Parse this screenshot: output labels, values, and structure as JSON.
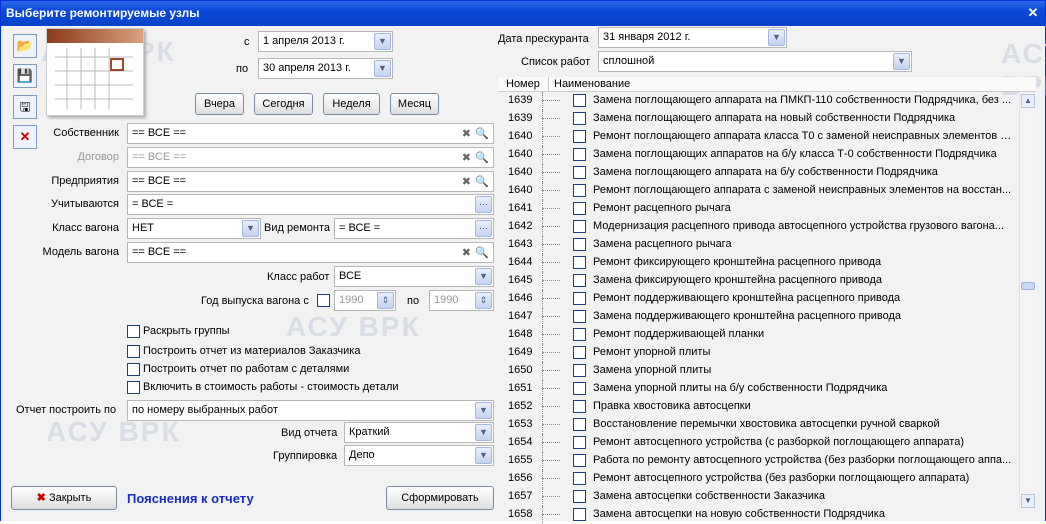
{
  "window": {
    "title": "Выберите ремонтируемые узлы",
    "close": "✕"
  },
  "dates": {
    "from_label": "с",
    "from": "1  апреля  2013 г.",
    "to_label": "по",
    "to": "30  апреля  2013 г."
  },
  "periods": [
    "Вчера",
    "Сегодня",
    "Неделя",
    "Месяц"
  ],
  "filters": {
    "owner": {
      "label": "Собственник",
      "value": "== ВСЕ =="
    },
    "contract": {
      "label": "Договор",
      "value": "== ВСЕ =="
    },
    "enterprise": {
      "label": "Предприятия",
      "value": "== ВСЕ =="
    },
    "counted": {
      "label": "Учитываются",
      "value": "= ВСЕ ="
    },
    "wagon_class": {
      "label": "Класс вагона",
      "value": "НЕТ"
    },
    "repair_type": {
      "label": "Вид ремонта",
      "value": "= ВСЕ ="
    },
    "wagon_model": {
      "label": "Модель вагона",
      "value": "== ВСЕ =="
    },
    "work_class": {
      "label": "Класс работ",
      "value": "ВСЕ"
    },
    "year": {
      "label": "Год выпуска вагона с",
      "from": "1990",
      "to_label": "по",
      "to": "1990"
    }
  },
  "options": [
    "Раскрыть группы",
    "Построить отчет из материалов Заказчика",
    "Построить отчет по работам с деталями",
    "Включить в стоимость работы - стоимость детали"
  ],
  "report": {
    "build_by_label": "Отчет построить по",
    "build_by": "по номеру выбранных работ",
    "kind_label": "Вид отчета",
    "kind": "Краткий",
    "group_label": "Группировка",
    "group": "Депо"
  },
  "buttons": {
    "close": "Закрыть",
    "explain": "Пояснения к отчету",
    "build": "Сформировать"
  },
  "pricelist": {
    "date_label": "Дата прескуранта",
    "date": "31  января   2012 г.",
    "worklist_label": "Список работ",
    "worklist": "сплошной"
  },
  "watermark": "АСУ ВРК",
  "list": {
    "headers": [
      "Номер",
      "Наименование"
    ],
    "rows": [
      {
        "n": "1639",
        "t": "Замена поглощающего аппарата на ПМКП-110 собственности Подрядчика, без ..."
      },
      {
        "n": "1639",
        "t": "Замена поглощающего аппарата на новый собственности Подрядчика"
      },
      {
        "n": "1640",
        "t": "Ремонт поглощающего аппарата класса Т0 с заменой неисправных элементов н..."
      },
      {
        "n": "1640",
        "t": "Замена поглощающих аппаратов на б/у класса Т-0 собственности Подрядчика"
      },
      {
        "n": "1640",
        "t": "Замена поглощающего аппарата на б/у собственности Подрядчика"
      },
      {
        "n": "1640",
        "t": "Ремонт поглощающего аппарата с заменой неисправных элементов на восстан..."
      },
      {
        "n": "1641",
        "t": "Ремонт расцепного рычага"
      },
      {
        "n": "1642",
        "t": "Модернизация расцепного привода автосцепного устройства грузового вагона..."
      },
      {
        "n": "1643",
        "t": "Замена расцепного рычага"
      },
      {
        "n": "1644",
        "t": "Ремонт фиксирующего кронштейна расцепного привода"
      },
      {
        "n": "1645",
        "t": "Замена фиксирующего кронштейна расцепного привода"
      },
      {
        "n": "1646",
        "t": "Ремонт поддерживающего кронштейна расцепного привода"
      },
      {
        "n": "1647",
        "t": "Замена поддерживающего кронштейна расцепного привода"
      },
      {
        "n": "1648",
        "t": "Ремонт поддерживающей планки"
      },
      {
        "n": "1649",
        "t": "Ремонт упорной плиты"
      },
      {
        "n": "1650",
        "t": "Замена упорной плиты"
      },
      {
        "n": "1651",
        "t": "Замена упорной плиты на б/у собственности Подрядчика"
      },
      {
        "n": "1652",
        "t": "Правка хвостовика автосцепки"
      },
      {
        "n": "1653",
        "t": "Восстановление перемычки хвостовика автосцепки ручной сваркой"
      },
      {
        "n": "1654",
        "t": "Ремонт автосцепного устройства (с разборкой поглощающего аппарата)"
      },
      {
        "n": "1655",
        "t": "Работа по ремонту автосцепного устройства (без разборки поглощающего аппа..."
      },
      {
        "n": "1656",
        "t": "Ремонт автосцепного устройства (без разборки поглощающего аппарата)"
      },
      {
        "n": "1657",
        "t": "Замена автосцепки собственности Заказчика"
      },
      {
        "n": "1658",
        "t": "Замена автосцепки на новую собственности Подрядчика"
      }
    ]
  }
}
